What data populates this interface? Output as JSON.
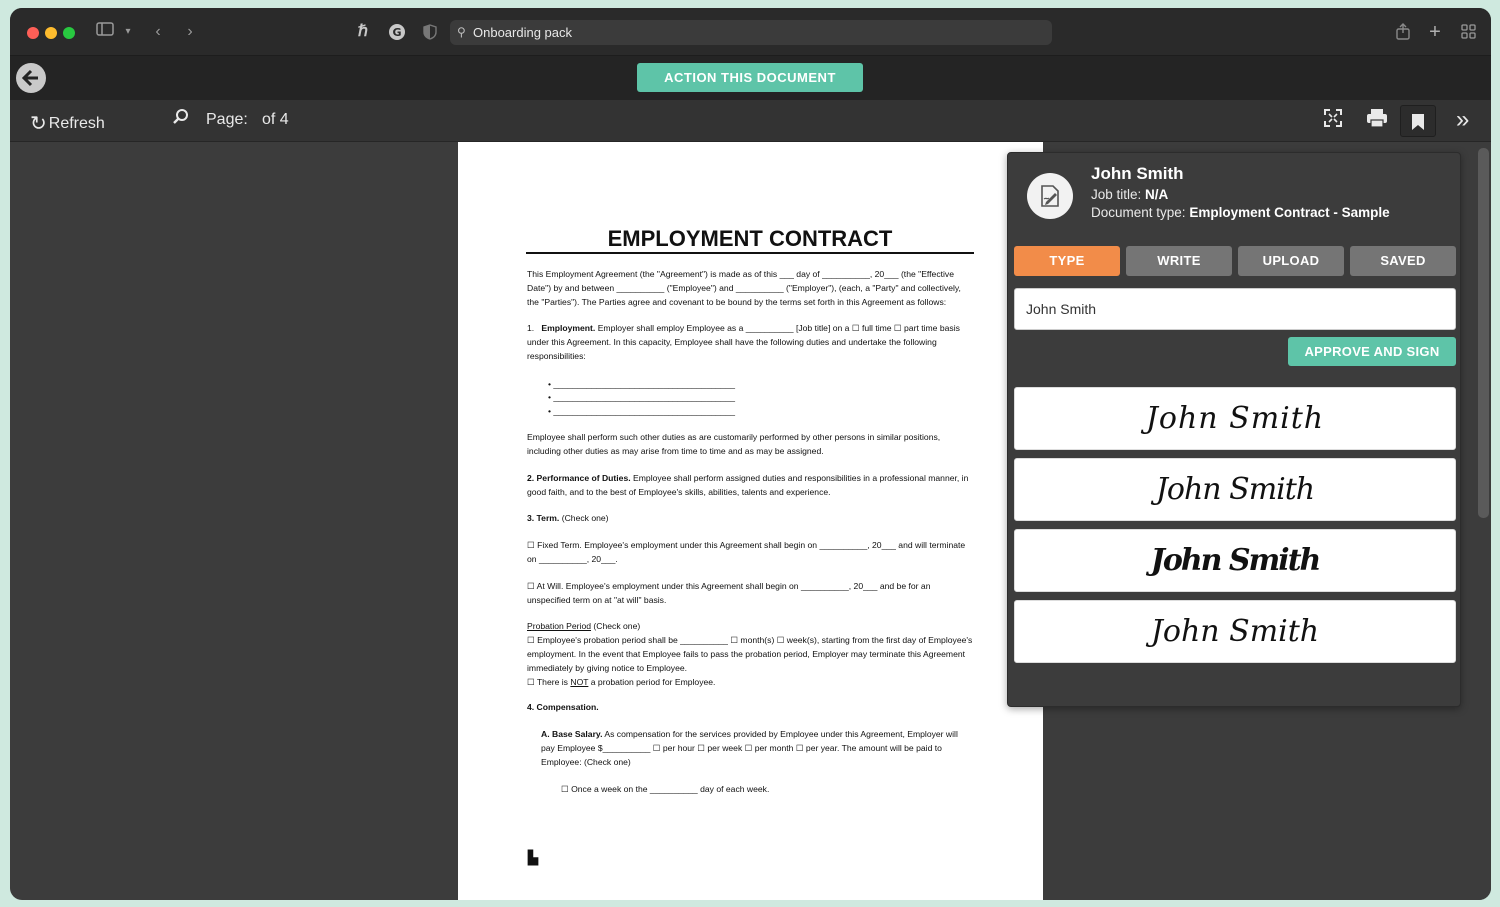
{
  "browser": {
    "address": "Onboarding pack",
    "icons": [
      "sidebar-icon",
      "chevron-down-icon",
      "back-icon",
      "forward-icon",
      "extension-icon",
      "grammarly-icon",
      "shield-icon",
      "share-icon",
      "plus-icon",
      "grid-icon"
    ]
  },
  "header": {
    "action_label": "ACTION THIS DOCUMENT"
  },
  "viewer": {
    "refresh_label": "Refresh",
    "page_label": "Page:",
    "page_of": "of 4"
  },
  "document": {
    "title": "EMPLOYMENT CONTRACT",
    "intro": "This Employment Agreement (the \"Agreement\") is made as of this ___ day of __________, 20___ (the \"Effective Date\") by and between __________ (\"Employee\") and __________ (\"Employer\"), (each, a \"Party\" and collectively, the \"Parties\"). The Parties agree and covenant to be bound by the terms set forth in this Agreement as follows:",
    "employment_head": "Employment.",
    "employment": "Employer shall employ Employee as a __________ [Job title] on a ☐ full time ☐ part time basis under this Agreement. In this capacity, Employee shall have the following duties and undertake the following responsibilities:",
    "bullet": "•  ______________________________________",
    "duties": "Employee shall perform such other duties as are customarily performed by other persons in similar positions, including other duties as may arise from time to time and as may be assigned.",
    "performance_head": "2. Performance of Duties.",
    "performance": "Employee shall perform assigned duties and responsibilities in a professional manner, in good faith, and to the best of Employee's skills, abilities, talents and experience.",
    "term_head": "3. Term.",
    "term_note": "(Check one)",
    "fixed_term": "☐  Fixed Term.  Employee's employment under this Agreement shall begin on __________, 20___ and will terminate on __________, 20___.",
    "at_will": "☐  At Will.  Employee's employment under this Agreement shall begin on __________, 20___ and be for an unspecified term on at \"at will\" basis.",
    "probation_head": "Probation Period",
    "probation_note": "(Check one)",
    "probation_1": "☐  Employee's probation period shall be __________ ☐ month(s) ☐ week(s), starting from the first day of Employee's employment. In the event that Employee fails to pass the probation period, Employer may terminate this Agreement immediately by giving notice to Employee.",
    "probation_2_pre": "☐  There is ",
    "probation_2_not": "NOT",
    "probation_2_post": " a probation period for Employee.",
    "comp_head": "4. Compensation.",
    "base_head": "A. Base Salary.",
    "base": "As compensation for the services provided by Employee under this Agreement, Employer will pay Employee $__________ ☐ per hour ☐ per week ☐ per month ☐ per year. The amount will be paid to Employee: (Check one)",
    "once_week": "☐  Once a week on the __________ day of each week.",
    "footer_mark": "▙"
  },
  "panel": {
    "name": "John Smith",
    "job_label": "Job title:",
    "job_value": "N/A",
    "doctype_label": "Document type:",
    "doctype_value": "Employment Contract - Sample",
    "tabs": [
      "TYPE",
      "WRITE",
      "UPLOAD",
      "SAVED"
    ],
    "active_tab": "TYPE",
    "input_value": "John Smith",
    "approve_label": "APPROVE AND SIGN",
    "signatures": [
      "John Smith",
      "John Smith",
      "John Smith",
      "John Smith"
    ]
  },
  "colors": {
    "accent_green": "#5ec4a8",
    "accent_orange": "#f28c49"
  }
}
